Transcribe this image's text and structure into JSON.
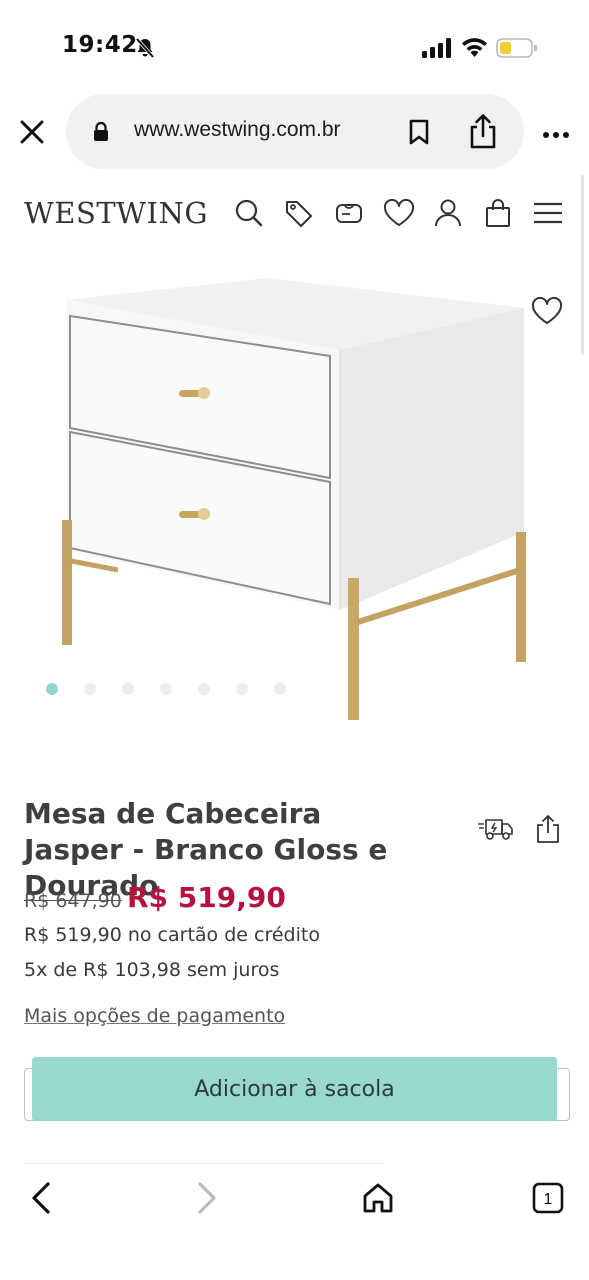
{
  "status_bar": {
    "time": "19:42",
    "icons": [
      "bell-slash-icon",
      "signal-icon",
      "wifi-icon",
      "battery-icon"
    ]
  },
  "browser": {
    "url": "www.westwing.com.br",
    "icons": [
      "close-icon",
      "lock-icon",
      "bookmark-icon",
      "share-icon",
      "more-icon"
    ]
  },
  "header": {
    "logo": "WESTWING",
    "icons": [
      "search-icon",
      "tag-icon",
      "voucher-icon",
      "heart-icon",
      "user-icon",
      "bag-icon",
      "menu-icon"
    ]
  },
  "gallery": {
    "image_count": 7,
    "active_index": 0,
    "accent_color": "#8fd6cd"
  },
  "product": {
    "title": "Mesa de Cabeceira Jasper - Branco Gloss e Dourado",
    "old_price": "R$ 647,90",
    "price": "R$ 519,90",
    "price_color": "#b5133f",
    "credit_line": "R$ 519,90 no cartão de crédito",
    "installments_line": "5x de R$ 103,98 sem juros",
    "payment_options_link": "Mais opções de pagamento",
    "add_to_cart_label": "Adicionar à sacola",
    "button_color": "#98d8cf"
  },
  "bottom_toolbar": {
    "tab_count": "1",
    "icons": [
      "back-icon",
      "forward-icon",
      "home-icon",
      "tabs-icon"
    ]
  }
}
